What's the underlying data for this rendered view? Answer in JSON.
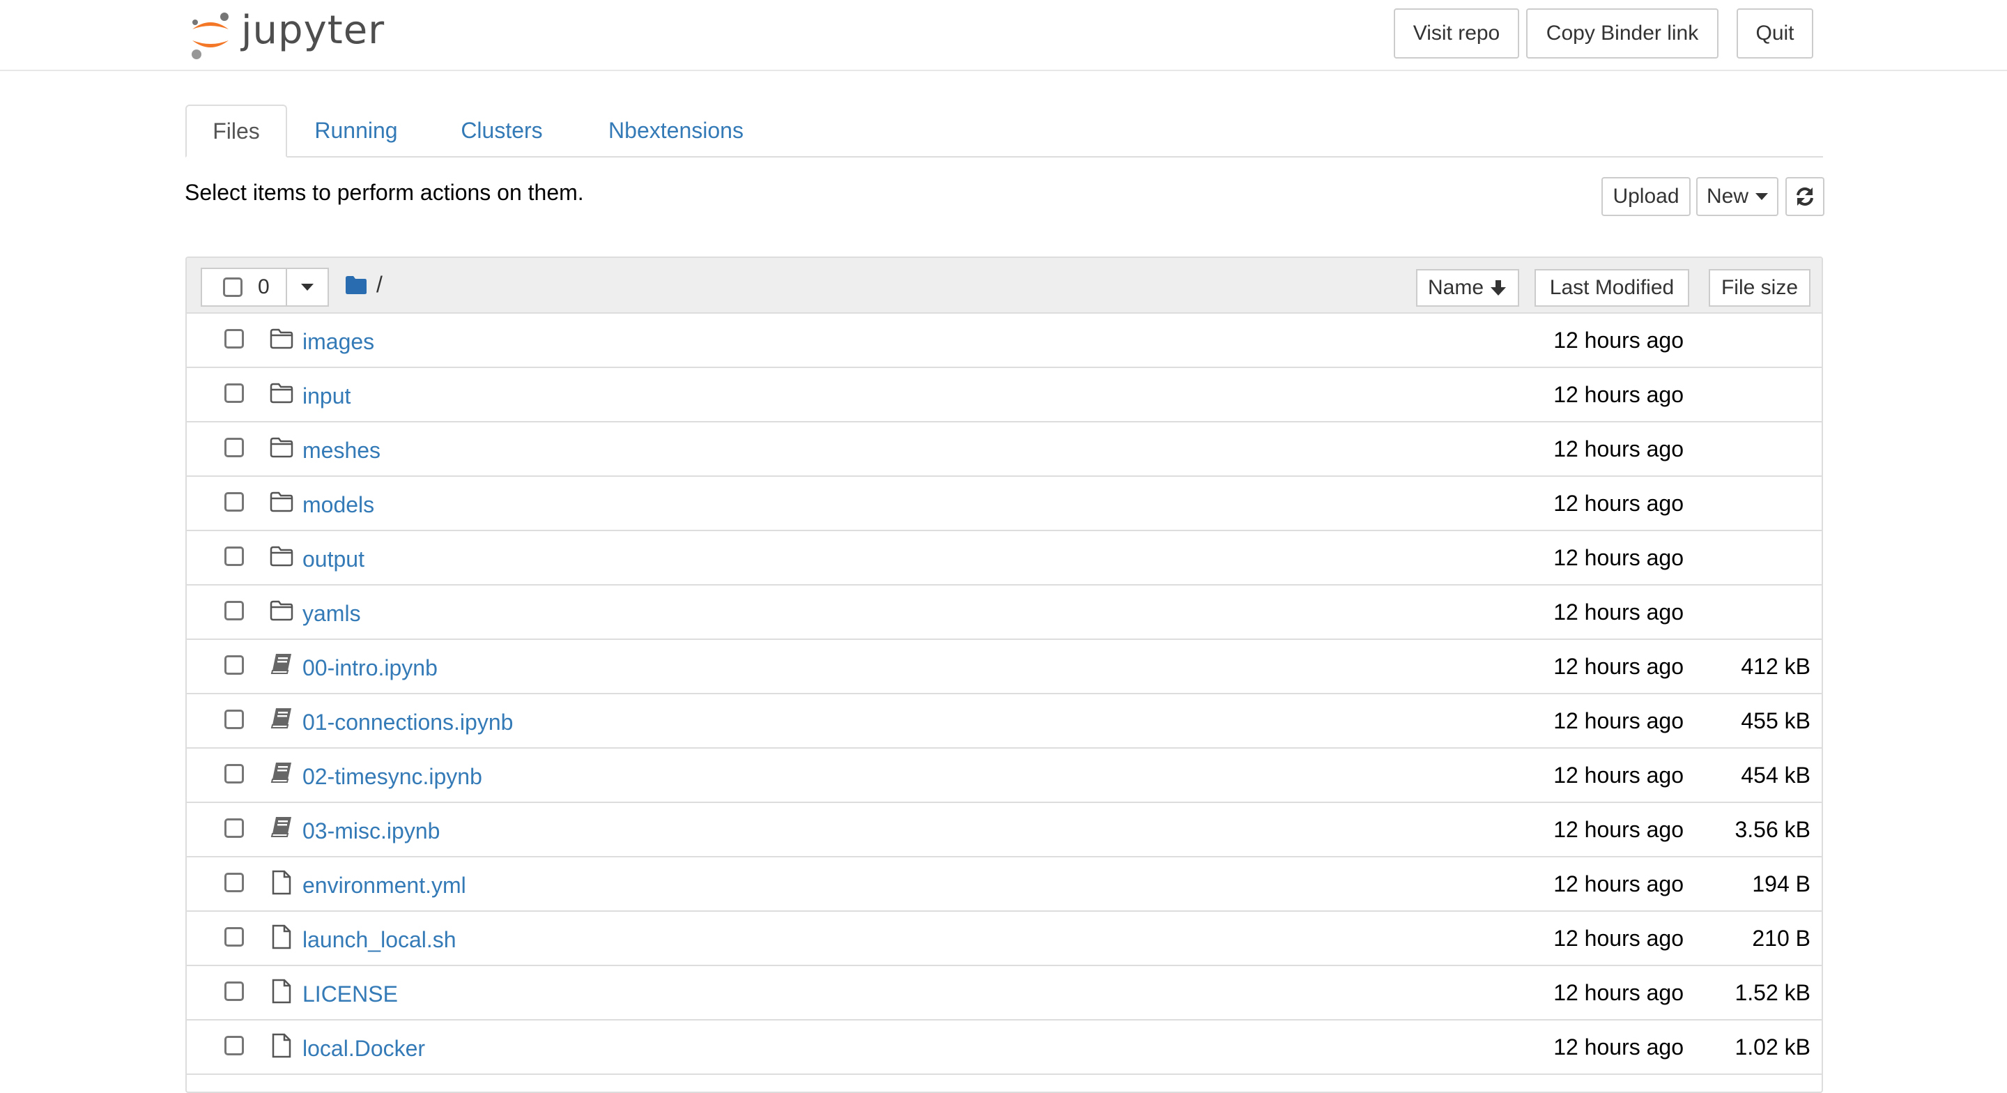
{
  "header": {
    "logo_text": "jupyter",
    "buttons": {
      "visit_repo": "Visit repo",
      "copy_binder": "Copy Binder link",
      "quit": "Quit"
    }
  },
  "tabs": [
    {
      "label": "Files",
      "active": true
    },
    {
      "label": "Running",
      "active": false
    },
    {
      "label": "Clusters",
      "active": false
    },
    {
      "label": "Nbextensions",
      "active": false
    }
  ],
  "toolbar": {
    "hint": "Select items to perform actions on them.",
    "upload": "Upload",
    "new": "New"
  },
  "list_header": {
    "selected_count": "0",
    "path": "/",
    "sort_name": "Name",
    "sort_modified": "Last Modified",
    "sort_size": "File size"
  },
  "colors": {
    "link": "#337ab7",
    "logo_orange": "#f37726",
    "border": "#dddddd",
    "header_bg": "#eeeeee"
  },
  "files": [
    {
      "name": "images",
      "type": "folder",
      "modified": "12 hours ago",
      "size": ""
    },
    {
      "name": "input",
      "type": "folder",
      "modified": "12 hours ago",
      "size": ""
    },
    {
      "name": "meshes",
      "type": "folder",
      "modified": "12 hours ago",
      "size": ""
    },
    {
      "name": "models",
      "type": "folder",
      "modified": "12 hours ago",
      "size": ""
    },
    {
      "name": "output",
      "type": "folder",
      "modified": "12 hours ago",
      "size": ""
    },
    {
      "name": "yamls",
      "type": "folder",
      "modified": "12 hours ago",
      "size": ""
    },
    {
      "name": "00-intro.ipynb",
      "type": "notebook",
      "modified": "12 hours ago",
      "size": "412 kB"
    },
    {
      "name": "01-connections.ipynb",
      "type": "notebook",
      "modified": "12 hours ago",
      "size": "455 kB"
    },
    {
      "name": "02-timesync.ipynb",
      "type": "notebook",
      "modified": "12 hours ago",
      "size": "454 kB"
    },
    {
      "name": "03-misc.ipynb",
      "type": "notebook",
      "modified": "12 hours ago",
      "size": "3.56 kB"
    },
    {
      "name": "environment.yml",
      "type": "file",
      "modified": "12 hours ago",
      "size": "194 B"
    },
    {
      "name": "launch_local.sh",
      "type": "file",
      "modified": "12 hours ago",
      "size": "210 B"
    },
    {
      "name": "LICENSE",
      "type": "file",
      "modified": "12 hours ago",
      "size": "1.52 kB"
    },
    {
      "name": "local.Docker",
      "type": "file",
      "modified": "12 hours ago",
      "size": "1.02 kB"
    }
  ]
}
